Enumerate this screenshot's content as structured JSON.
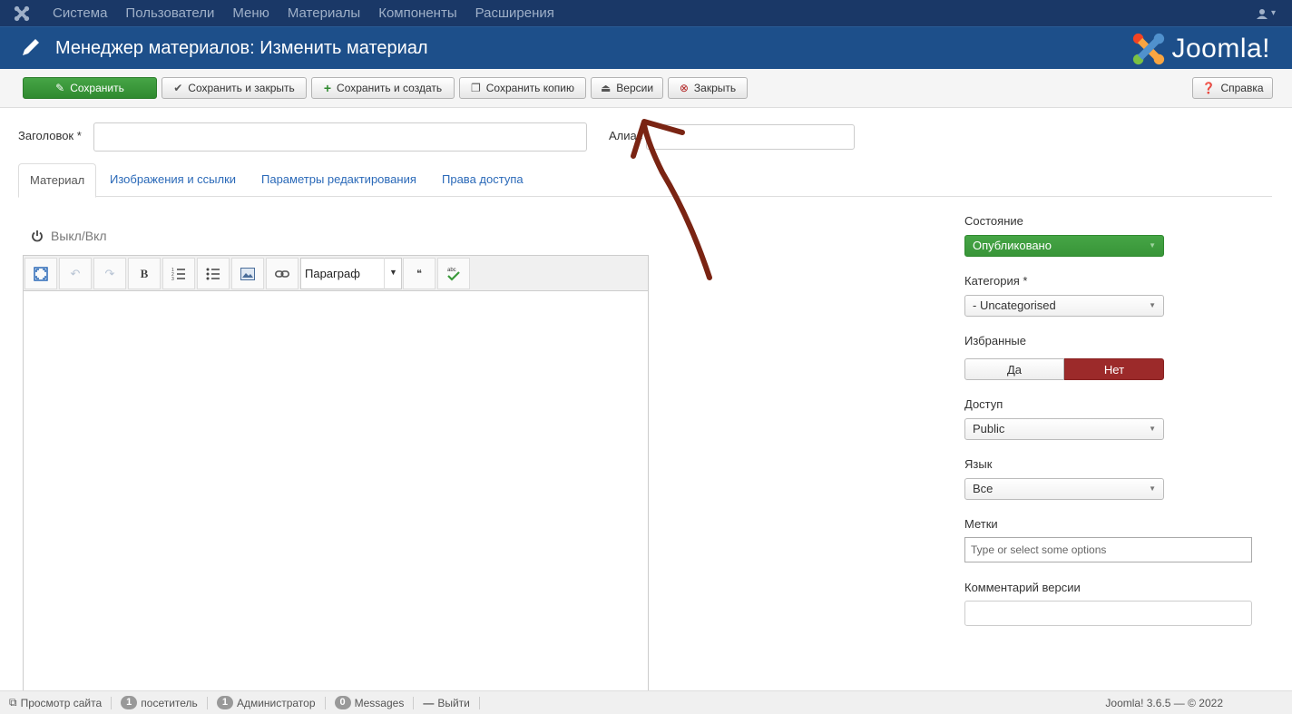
{
  "colors": {
    "topnav": "#1a3867",
    "header": "#1d4f8a",
    "save_green": "#3a983a",
    "no_red": "#9c2a2a",
    "link_blue": "#2a69b8",
    "annotation": "#7a2413"
  },
  "topnav": {
    "items": [
      "Система",
      "Пользователи",
      "Меню",
      "Материалы",
      "Компоненты",
      "Расширения"
    ],
    "logo_icon": "joomla-icon",
    "user_icon": "user-icon"
  },
  "header": {
    "title": "Менеджер материалов: Изменить материал",
    "brand": "Joomla!",
    "title_icon": "pencil-icon"
  },
  "toolbar": {
    "save": "Сохранить",
    "save_close": "Сохранить и закрыть",
    "save_new": "Сохранить и создать",
    "save_copy": "Сохранить копию",
    "versions": "Версии",
    "close": "Закрыть",
    "help": "Справка"
  },
  "form": {
    "title_label": "Заголовок *",
    "title_value": "",
    "alias_label": "Алиас",
    "alias_value": ""
  },
  "tabs": [
    "Материал",
    "Изображения и ссылки",
    "Параметры редактирования",
    "Права доступа"
  ],
  "editor": {
    "toggle_label": "Выкл/Вкл",
    "format_value": "Параграф",
    "content": ""
  },
  "sidebar": {
    "status_label": "Состояние",
    "status_value": "Опубликовано",
    "category_label": "Категория *",
    "category_value": "- Uncategorised",
    "featured_label": "Избранные",
    "featured_yes": "Да",
    "featured_no": "Нет",
    "featured_selected": "Нет",
    "access_label": "Доступ",
    "access_value": "Public",
    "language_label": "Язык",
    "language_value": "Все",
    "tags_label": "Метки",
    "tags_placeholder": "Type or select some options",
    "version_note_label": "Комментарий версии",
    "version_note_value": ""
  },
  "statusbar": {
    "view_site": "Просмотр сайта",
    "visitors_count": "1",
    "visitors_label": "посетитель",
    "admins_count": "1",
    "admins_label": "Администратор",
    "messages_count": "0",
    "messages_label": "Messages",
    "logout": "Выйти",
    "version": "Joomla! 3.6.5 — © 2022"
  }
}
